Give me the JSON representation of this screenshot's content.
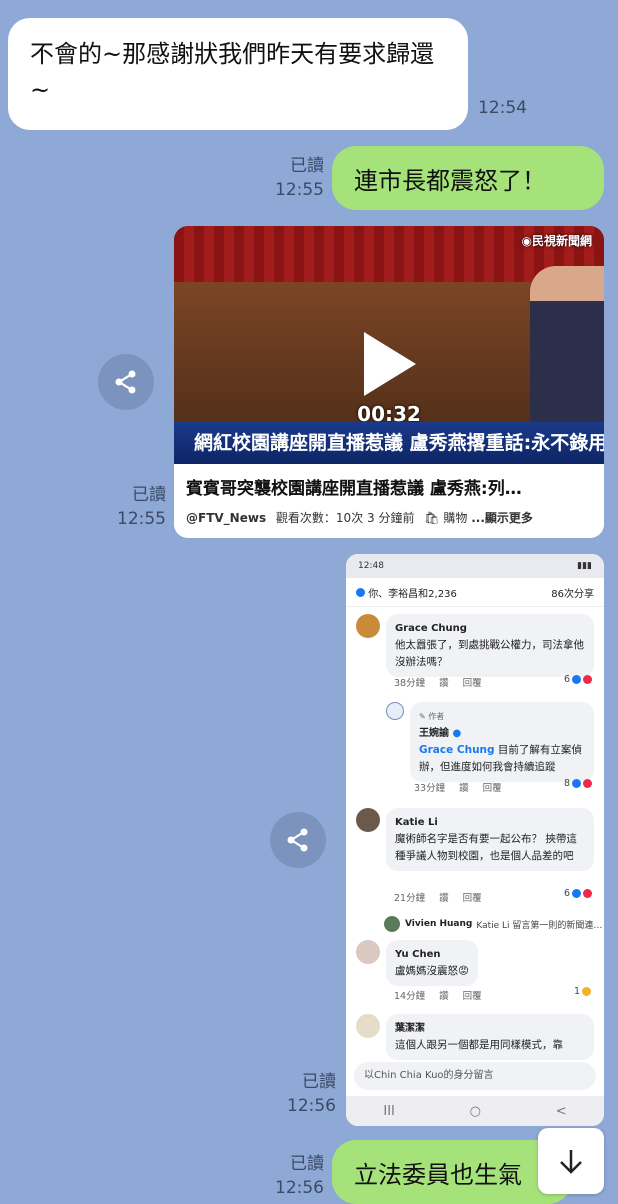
{
  "messages": {
    "incoming_1": {
      "text": "不會的~那感謝狀我們昨天有要求歸還~",
      "time": "12:54"
    },
    "outgoing_1": {
      "read": "已讀",
      "time": "12:55",
      "text": "連市長都震怒了！"
    },
    "video": {
      "read": "已讀",
      "time": "12:55",
      "logo": "◉民視新聞網",
      "duration": "00:32",
      "caption": "網紅校園講座開直播惹議 盧秀燕撂重話:永不錄用",
      "title": "賓賓哥突襲校園講座開直播惹議 盧秀燕:列…",
      "channel": "@FTV_News",
      "meta": "觀看次數：10次  3 分鐘前",
      "shop": "購物",
      "more": "...顯示更多"
    },
    "screenshot": {
      "read": "已讀",
      "time": "12:56",
      "statusbar_time": "12:48",
      "reactions": "你、李裕昌和2,236",
      "shares": "86次分享",
      "comments": [
        {
          "name": "Grace Chung",
          "text": "他太囂張了，到處挑戰公權力，司法拿他沒辦法嗎？",
          "time": "38分鐘",
          "like": "讚",
          "reply": "回覆",
          "count": "6"
        },
        {
          "role": "✎ 作者",
          "name": "王婉諭",
          "mention": "Grace Chung",
          "text": " 目前了解有立案偵辦，但進度如何我會持續追蹤",
          "time": "33分鐘",
          "like": "讚",
          "reply": "回覆",
          "count": "8"
        },
        {
          "name": "Katie Li",
          "text": "魔術師名字是否有要一起公布？ 挾帶這種爭議人物到校園，也是個人品差的吧",
          "time": "21分鐘",
          "like": "讚",
          "reply": "回覆",
          "count": "6"
        },
        {
          "name": "Vivien Huang",
          "text": "Katie Li 留言第一則的新聞連…"
        },
        {
          "name": "Yu Chen",
          "text": "盧媽媽沒震怒😡",
          "time": "14分鐘",
          "like": "讚",
          "reply": "回覆",
          "count": "1"
        },
        {
          "name": "葉潔潔",
          "text": "這個人跟另一個都是用同樣模式，靠"
        }
      ],
      "input_placeholder": "以Chin Chia Kuo的身分留言",
      "nav": [
        "III",
        "○",
        "<"
      ]
    },
    "outgoing_2": {
      "read": "已讀",
      "time": "12:56",
      "text": "立法委員也生氣"
    }
  },
  "colors": {
    "background": "#8fa9d6",
    "outgoing": "#a6e27a",
    "incoming": "#ffffff"
  },
  "icons": {
    "share": "share-icon",
    "scroll": "arrow-down-icon",
    "play": "play-icon"
  }
}
